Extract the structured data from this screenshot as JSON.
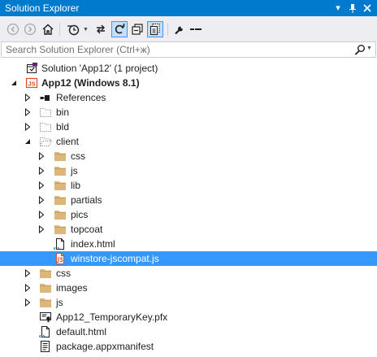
{
  "window": {
    "title": "Solution Explorer",
    "title_buttons": {
      "dropdown": "▾",
      "pin": "⊥",
      "close": "×"
    }
  },
  "toolbar": {
    "buttons": [
      {
        "name": "back-button",
        "icon": "back-arrow-icon"
      },
      {
        "name": "forward-button",
        "icon": "forward-arrow-icon"
      },
      {
        "name": "home-button",
        "icon": "home-icon"
      },
      {
        "name": "pending-changes-filter-button",
        "icon": "clock-filter-icon"
      },
      {
        "name": "sync-with-active-document-button",
        "icon": "sync-arrows-icon"
      },
      {
        "name": "refresh-button",
        "icon": "refresh-icon",
        "active": true
      },
      {
        "name": "collapse-all-button",
        "icon": "collapse-all-icon"
      },
      {
        "name": "show-all-files-button",
        "icon": "show-all-files-icon",
        "active": true
      },
      {
        "name": "properties-button",
        "icon": "wrench-icon"
      },
      {
        "name": "preview-selected-items-button",
        "icon": "preview-icon"
      }
    ]
  },
  "search": {
    "placeholder": "Search Solution Explorer (Ctrl+ж)",
    "value": ""
  },
  "tree": [
    {
      "label": "Solution 'App12' (1 project)",
      "icon": "solution-icon",
      "level": 0,
      "expander": "none"
    },
    {
      "label": "App12 (Windows 8.1)",
      "icon": "js-project-icon",
      "level": 0,
      "expander": "expanded",
      "bold": true
    },
    {
      "label": "References",
      "icon": "references-icon",
      "level": 1,
      "expander": "collapsed"
    },
    {
      "label": "bin",
      "icon": "folder-hidden-icon",
      "level": 1,
      "expander": "collapsed"
    },
    {
      "label": "bld",
      "icon": "folder-hidden-icon",
      "level": 1,
      "expander": "collapsed"
    },
    {
      "label": "client",
      "icon": "folder-open-icon",
      "level": 1,
      "expander": "expanded"
    },
    {
      "label": "css",
      "icon": "folder-icon",
      "level": 2,
      "expander": "collapsed"
    },
    {
      "label": "js",
      "icon": "folder-icon",
      "level": 2,
      "expander": "collapsed"
    },
    {
      "label": "lib",
      "icon": "folder-icon",
      "level": 2,
      "expander": "collapsed"
    },
    {
      "label": "partials",
      "icon": "folder-icon",
      "level": 2,
      "expander": "collapsed"
    },
    {
      "label": "pics",
      "icon": "folder-icon",
      "level": 2,
      "expander": "collapsed"
    },
    {
      "label": "topcoat",
      "icon": "folder-icon",
      "level": 2,
      "expander": "collapsed"
    },
    {
      "label": "index.html",
      "icon": "html-file-icon",
      "level": 2,
      "expander": "none"
    },
    {
      "label": "winstore-jscompat.js",
      "icon": "js-file-icon",
      "level": 2,
      "expander": "none",
      "selected": true
    },
    {
      "label": "css",
      "icon": "folder-icon",
      "level": 1,
      "expander": "collapsed"
    },
    {
      "label": "images",
      "icon": "folder-icon",
      "level": 1,
      "expander": "collapsed"
    },
    {
      "label": "js",
      "icon": "folder-icon",
      "level": 1,
      "expander": "collapsed"
    },
    {
      "label": "App12_TemporaryKey.pfx",
      "icon": "certificate-icon",
      "level": 1,
      "expander": "none"
    },
    {
      "label": "default.html",
      "icon": "html-file-icon",
      "level": 1,
      "expander": "none"
    },
    {
      "label": "package.appxmanifest",
      "icon": "manifest-icon",
      "level": 1,
      "expander": "none"
    }
  ],
  "colors": {
    "accent": "#007acc",
    "selection": "#3399ff",
    "toolbar_bg": "#eeeef2",
    "folder": "#dcb67a",
    "js_badge": "#e04a1f"
  }
}
